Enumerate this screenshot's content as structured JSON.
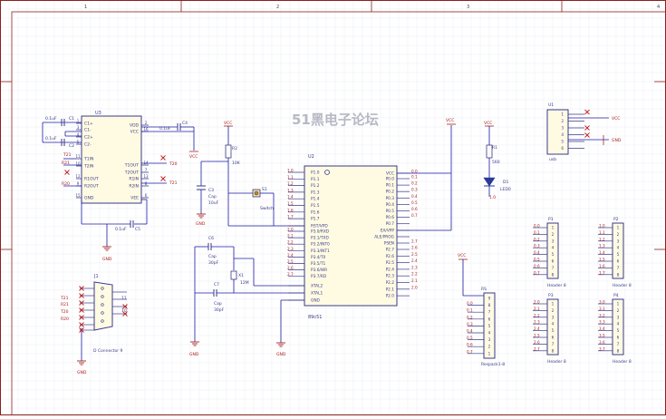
{
  "frame": {
    "columns": [
      "1",
      "2",
      "3",
      "4"
    ],
    "colors": {
      "border": "#8a2020",
      "wire": "#1a1aa6",
      "part": "#3a3a8a",
      "power": "#aa2020",
      "grid": "#dde2ef",
      "ic_fill": "#fffbe3"
    }
  },
  "watermark": "51黑电子论坛",
  "u3": {
    "ref": "U3",
    "left_pins": [
      {
        "num": "1",
        "name": "C1+"
      },
      {
        "num": "3",
        "name": "C1-"
      },
      {
        "num": "4",
        "name": "C2+"
      },
      {
        "num": "5",
        "name": "C2-"
      },
      {
        "num": "11",
        "name": "T1IN"
      },
      {
        "num": "10",
        "name": "T2IN"
      },
      {
        "num": "12",
        "name": "R1OUT"
      },
      {
        "num": "9",
        "name": "R2OUT"
      },
      {
        "num": "15",
        "name": "GND"
      }
    ],
    "right_pins": [
      {
        "num": "2",
        "name": "VDD"
      },
      {
        "num": "16",
        "name": "VCC"
      },
      {
        "num": "14",
        "name": "T1OUT"
      },
      {
        "num": "7",
        "name": "T2OUT"
      },
      {
        "num": "13",
        "name": "R1IN"
      },
      {
        "num": "8",
        "name": "R2IN"
      },
      {
        "num": "6",
        "name": "VEE"
      }
    ],
    "caps": {
      "c1": "C1",
      "c2": "C2",
      "c3": "C3",
      "c4": "C4",
      "c5": "C5",
      "value": "0.1uF"
    },
    "nets": {
      "t21_in": "T21",
      "r21_out": "R21",
      "r20_out": "R20",
      "t20_out": "T20",
      "t21_out": "T21",
      "r21_in": "R21"
    }
  },
  "j1": {
    "ref": "J1",
    "name": "D Connector 9",
    "pins_left": [
      "T21",
      "R21",
      "T20",
      "R20"
    ],
    "pins_right": [
      "11",
      "10"
    ],
    "gnd": "GND"
  },
  "u2": {
    "ref": "U2",
    "name": "89c51",
    "left_pins": [
      "P1.0",
      "P1.1",
      "P1.2",
      "P1.3",
      "P1.4",
      "P1.5",
      "P1.6",
      "P1.7",
      "RST/VPD",
      "P3.0/RXD",
      "P3.1/TXD",
      "P3.2/INT0",
      "P3.3/INT1",
      "P3.4/T0",
      "P3.5/T1",
      "P3.6/WR",
      "P3.7/RD",
      "XTAL2",
      "XTAL1",
      "GND"
    ],
    "right_pins": [
      "VCC",
      "P0.0",
      "P0.1",
      "P0.2",
      "P0.3",
      "P0.4",
      "P0.5",
      "P0.6",
      "P0.7",
      "EA/VPP",
      "ALE/PROG",
      "PSEN",
      "P2.7",
      "P2.6",
      "P2.5",
      "P2.4",
      "P2.3",
      "P2.2",
      "P2.1",
      "P2.0"
    ],
    "left_nets": [
      "1.0",
      "1.1",
      "1.2",
      "1.3",
      "1.4",
      "1.5",
      "1.6",
      "1.7",
      "",
      "2.0",
      "2.1",
      "2.2",
      "2.3",
      "2.4",
      "2.5",
      "2.6",
      "2.7"
    ],
    "right_nets": [
      "0.0",
      "0.1",
      "0.2",
      "0.3",
      "0.4",
      "0.5",
      "0.6",
      "0.7",
      "",
      "",
      "",
      "2.7",
      "2.6",
      "2.5",
      "2.4",
      "2.3",
      "2.2",
      "2.1",
      "2.0"
    ]
  },
  "reset": {
    "r2_ref": "R2",
    "r2_val": "10K",
    "c3_ref": "C3",
    "c3_name": "Cap",
    "c3_val": "10uF",
    "s1_ref": "S1",
    "s1_name": "Switch"
  },
  "osc": {
    "c6_ref": "C6",
    "c6_name": "Cap",
    "c6_val": "30pF",
    "c7_ref": "C7",
    "c7_name": "Cap",
    "c7_val": "30pF",
    "x1_ref": "X1",
    "x1_val": "12M"
  },
  "led": {
    "r1_ref": "R1",
    "r1_val": "560",
    "d1_ref": "D1",
    "d1_name": "LED0",
    "net": "1.0"
  },
  "u1": {
    "ref": "U1",
    "name": "usb",
    "pins": [
      "1",
      "2",
      "3",
      "4",
      "5",
      "6"
    ],
    "vcc": "VCC",
    "gnd": "GND"
  },
  "rs": {
    "ref": "RS",
    "name": "Respack1-8",
    "nets": [
      "0.0",
      "0.1",
      "0.2",
      "0.3",
      "0.4",
      "0.5",
      "0.6",
      "0.7"
    ],
    "pins": [
      "9",
      "8",
      "7",
      "6",
      "5",
      "4",
      "3",
      "2",
      "1"
    ]
  },
  "headers": [
    {
      "ref": "P1",
      "name": "Header 8",
      "nets": [
        "0.0",
        "0.1",
        "0.2",
        "0.3",
        "0.4",
        "0.5",
        "0.6",
        "0.7"
      ]
    },
    {
      "ref": "P2",
      "name": "Header 8",
      "nets": [
        "1.0",
        "1.1",
        "1.2",
        "1.3",
        "1.4",
        "1.5",
        "1.6",
        "1.7"
      ]
    },
    {
      "ref": "P3",
      "name": "Header 8",
      "nets": [
        "2.0",
        "2.1",
        "2.2",
        "2.3",
        "2.4",
        "2.5",
        "2.6",
        "2.7"
      ]
    },
    {
      "ref": "P4",
      "name": "Header 8",
      "nets": [
        "3.0",
        "3.1",
        "3.2",
        "3.3",
        "3.4",
        "3.5",
        "3.6",
        "3.7"
      ]
    }
  ],
  "power": {
    "vcc": "VCC",
    "gnd": "GND"
  }
}
